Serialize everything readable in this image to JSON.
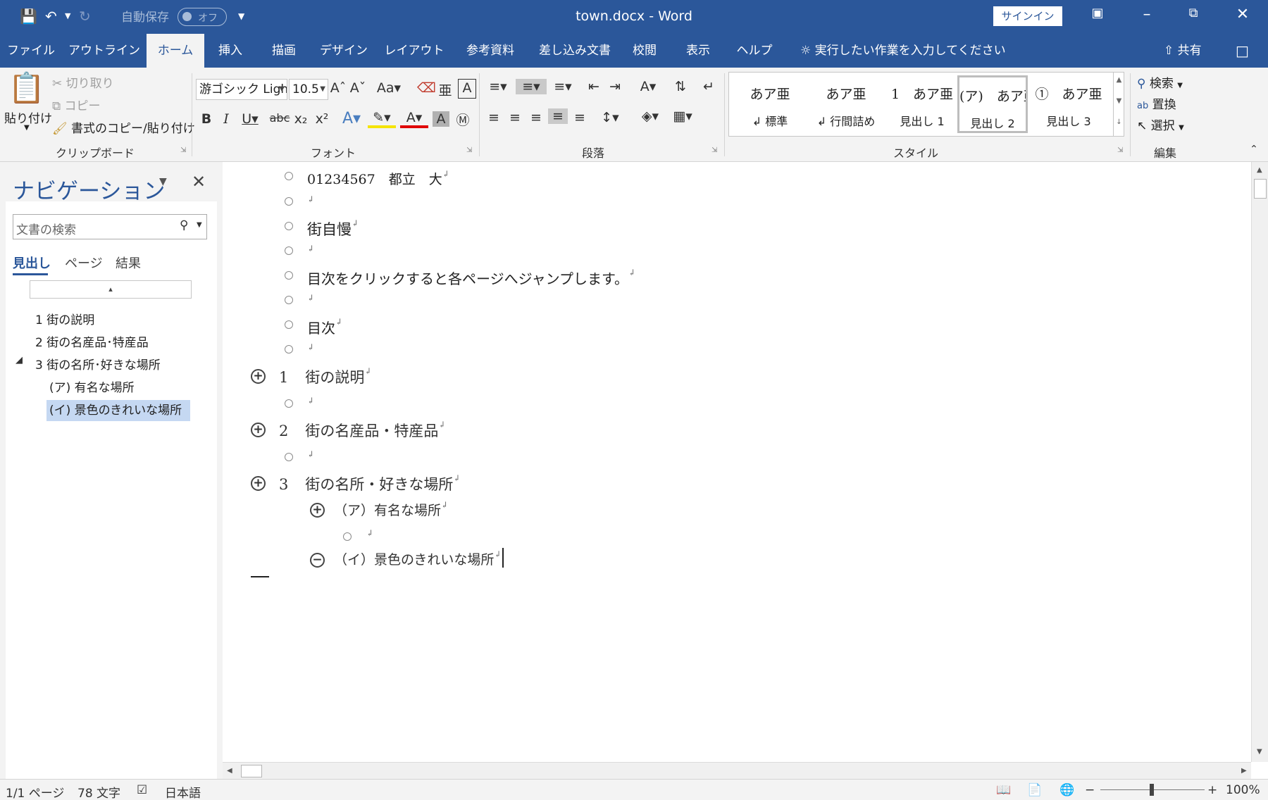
{
  "window": {
    "title": "town.docx  -  Word",
    "autosave_label": "自動保存",
    "autosave_state": "オフ",
    "signin_label": "サインイン"
  },
  "tabs": [
    {
      "label": "ファイル"
    },
    {
      "label": "アウトライン"
    },
    {
      "label": "ホーム"
    },
    {
      "label": "挿入"
    },
    {
      "label": "描画"
    },
    {
      "label": "デザイン"
    },
    {
      "label": "レイアウト"
    },
    {
      "label": "参考資料"
    },
    {
      "label": "差し込み文書"
    },
    {
      "label": "校閲"
    },
    {
      "label": "表示"
    },
    {
      "label": "ヘルプ"
    }
  ],
  "active_tab": "ホーム",
  "tell_me": "実行したい作業を入力してください",
  "share_label": "共有",
  "clipboard": {
    "paste": "貼り付け",
    "cut": "切り取り",
    "copy": "コピー",
    "format_painter": "書式のコピー/貼り付け",
    "group_label": "クリップボード"
  },
  "font": {
    "font_name": "游ゴシック Ligh",
    "font_size": "10.5",
    "group_label": "フォント"
  },
  "paragraph": {
    "group_label": "段落"
  },
  "styles": {
    "items": [
      {
        "preview": "あア亜",
        "name": "↲ 標準"
      },
      {
        "preview": "あア亜",
        "name": "↲ 行間詰め"
      },
      {
        "preview": "1　あア亜",
        "name": "見出し 1"
      },
      {
        "preview": "(ア)　あア亜",
        "name": "見出し 2"
      },
      {
        "preview": "①　あア亜",
        "name": "見出し 3"
      }
    ],
    "selected_index": 3,
    "group_label": "スタイル"
  },
  "editing": {
    "find": "検索",
    "replace": "置換",
    "select": "選択",
    "group_label": "編集"
  },
  "nav_pane": {
    "title": "ナビゲーション",
    "search_placeholder": "文書の検索",
    "tabs": [
      "見出し",
      "ページ",
      "結果"
    ],
    "headings": [
      {
        "text": "1  街の説明"
      },
      {
        "text": "2  街の名産品･特産品"
      },
      {
        "text": "3  街の名所･好きな場所"
      },
      {
        "text": "(ア) 有名な場所"
      },
      {
        "text": "(イ) 景色のきれいな場所"
      }
    ],
    "selected_heading": "(イ) 景色のきれいな場所"
  },
  "document": {
    "lines": [
      "01234567　都立　大",
      "",
      "街自慢",
      "",
      "目次をクリックすると各ページへジャンプします。",
      "",
      "目次",
      ""
    ],
    "headings": [
      {
        "num": "1",
        "text": "街の説明"
      },
      {
        "num": "2",
        "text": "街の名産品・特産品"
      },
      {
        "num": "3",
        "text": "街の名所・好きな場所"
      }
    ],
    "subheadings": [
      {
        "text": "（ア）有名な場所"
      },
      {
        "text": "（イ）景色のきれいな場所"
      }
    ],
    "paragraph_mark": "↲"
  },
  "status_bar": {
    "page": "1/1 ページ",
    "words": "78 文字",
    "language": "日本語",
    "zoom": "100%"
  },
  "colors": {
    "accent": "#2b579a",
    "ribbon_bg": "#f3f3f3",
    "nav_selected": "#c5d8f2"
  }
}
